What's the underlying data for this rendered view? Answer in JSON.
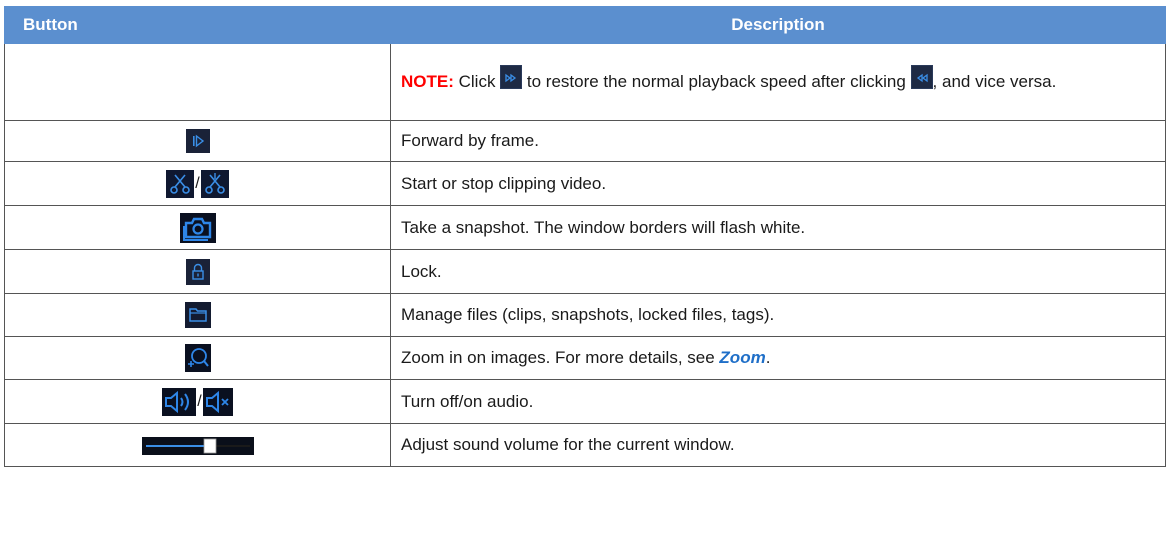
{
  "header": {
    "button": "Button",
    "description": "Description"
  },
  "note": {
    "label": "NOTE:",
    "part1": " Click ",
    "part2": " to restore the normal playback speed after clicking ",
    "part3": ", and vice versa.",
    "icon1": "fast-forward-icon",
    "icon2": "rewind-icon"
  },
  "rows": [
    {
      "icon": "forward-frame-icon",
      "desc": "Forward by frame."
    },
    {
      "icon": "scissors-icon",
      "icon_alt": "scissors-stop-icon",
      "separator": "/",
      "desc": "Start or stop clipping video."
    },
    {
      "icon": "camera-snapshot-icon",
      "desc": "Take a snapshot. The window borders will flash white."
    },
    {
      "icon": "lock-icon",
      "desc": "Lock."
    },
    {
      "icon": "folder-icon",
      "desc": "Manage files (clips, snapshots, locked files, tags)."
    },
    {
      "icon": "zoom-icon",
      "desc_prefix": "Zoom in on images. For more details, see ",
      "link": "Zoom",
      "desc_suffix": "."
    },
    {
      "icon": "speaker-on-icon",
      "icon_alt": "speaker-muted-icon",
      "separator": "/",
      "desc": "Turn off/on audio."
    },
    {
      "icon": "volume-slider-icon",
      "desc": "Adjust sound volume for the current window."
    }
  ],
  "colors": {
    "header_bg": "#5b8fcf",
    "note_label": "#ff0000",
    "link": "#1f6fc8",
    "icon_bg": "#0c1220",
    "icon_fg": "#3a8ee6"
  }
}
